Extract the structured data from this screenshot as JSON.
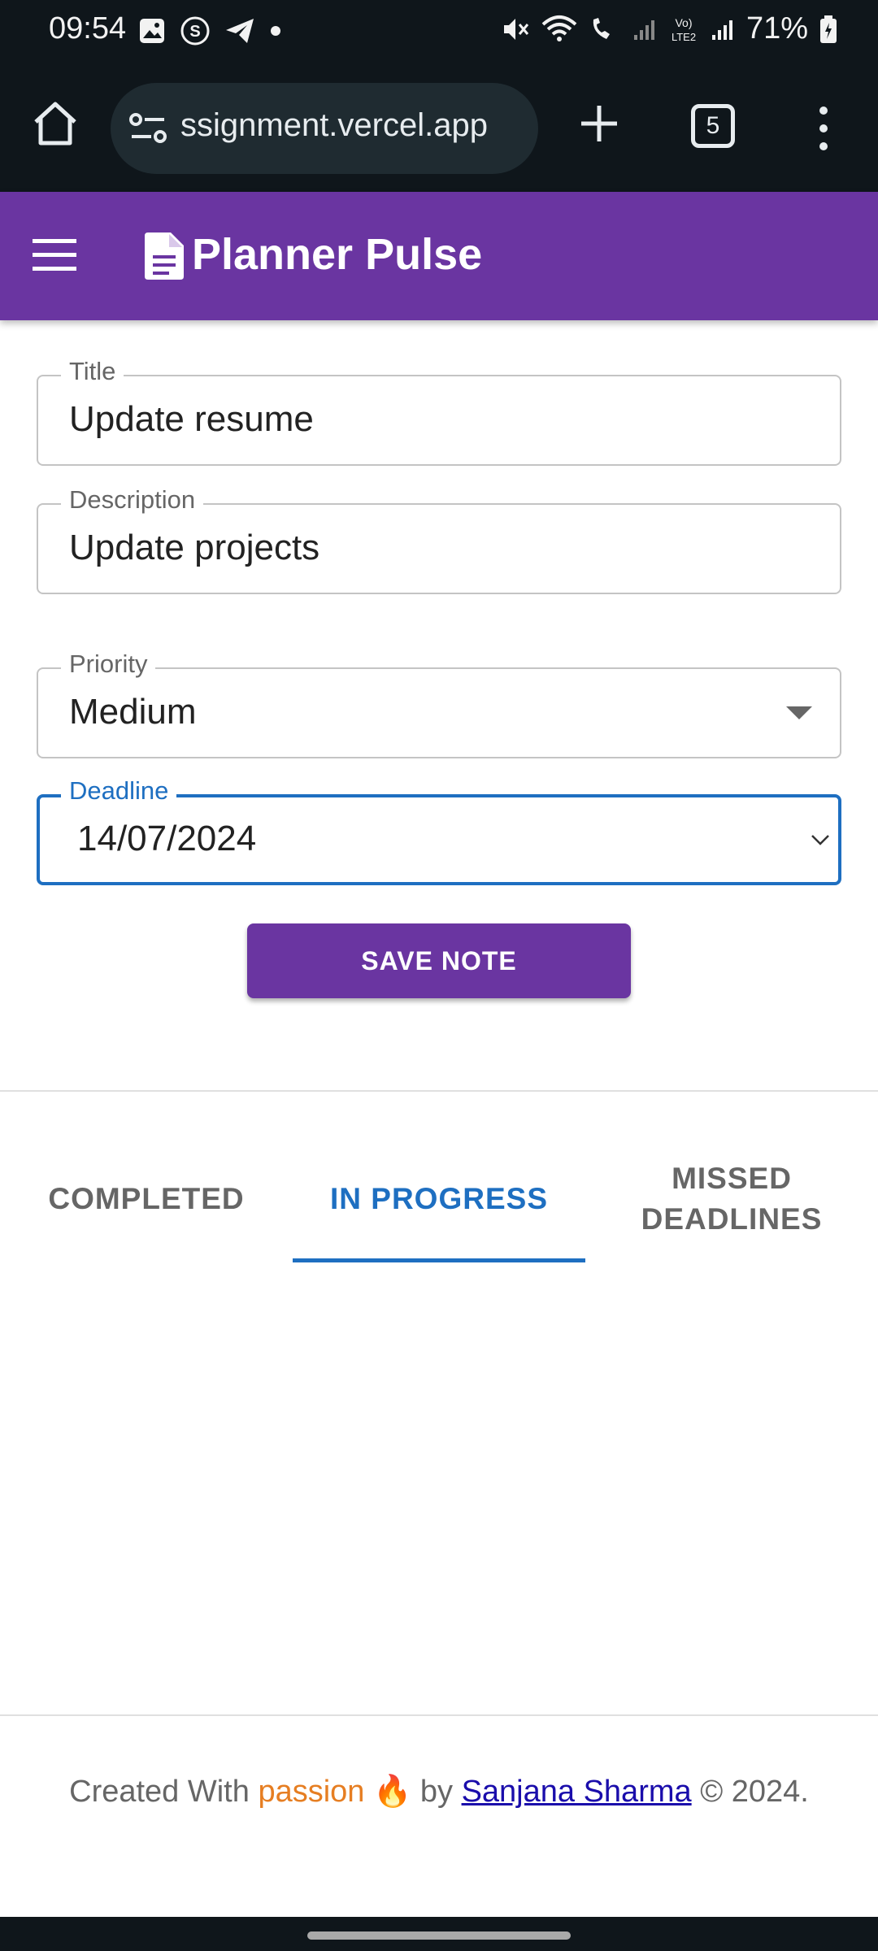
{
  "status_bar": {
    "time": "09:54",
    "battery": "71%",
    "icons": [
      "image-icon",
      "s-app-icon",
      "telegram-icon",
      "dot-icon",
      "mute-icon",
      "wifi-icon",
      "wifi-call-icon",
      "signal-icon",
      "volte-icon",
      "signal-icon",
      "battery-icon"
    ]
  },
  "browser": {
    "url": "ssignment.vercel.app",
    "tab_count": "5"
  },
  "app": {
    "title": "Planner Pulse"
  },
  "form": {
    "title": {
      "label": "Title",
      "value": "Update resume"
    },
    "description": {
      "label": "Description",
      "value": "Update projects"
    },
    "priority": {
      "label": "Priority",
      "value": "Medium"
    },
    "deadline": {
      "label": "Deadline",
      "value": "14/07/2024"
    },
    "save_label": "SAVE NOTE"
  },
  "tabs": [
    {
      "label": "COMPLETED",
      "active": false
    },
    {
      "label": "IN PROGRESS",
      "active": true
    },
    {
      "label": "MISSED DEADLINES",
      "active": false
    }
  ],
  "footer": {
    "prefix": "Created With ",
    "passion": "passion",
    "emoji": "🔥",
    "by": " by ",
    "author": "Sanjana Sharma",
    "suffix": " © 2024."
  },
  "colors": {
    "accent": "#6a35a1",
    "focus": "#1e6fc1",
    "passion": "#e67e22"
  }
}
